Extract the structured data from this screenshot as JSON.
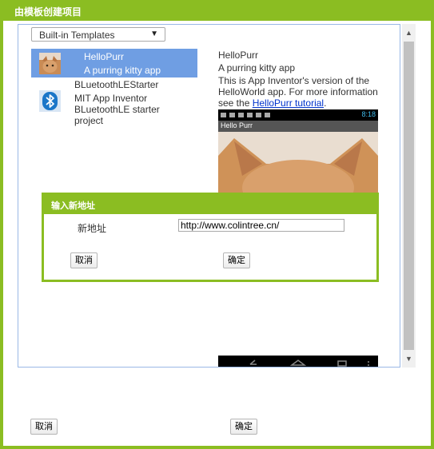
{
  "outer_dialog": {
    "title": "由模板创建项目",
    "cancel_label": "取消",
    "ok_label": "确定"
  },
  "template_select": {
    "value": "Built-in Templates",
    "arrow": "▼"
  },
  "templates": [
    {
      "name": "HelloPurr",
      "description": "A purring kitty app",
      "icon": "cat-thumbnail-icon",
      "selected": true
    },
    {
      "name": "BLuetoothLEStarter",
      "description": "MIT App Inventor BLuetoothLE starter project",
      "icon": "bluetooth-icon",
      "selected": false
    }
  ],
  "preview": {
    "title": "HelloPurr",
    "subtitle": "A purring kitty app",
    "description_prefix": "This is App Inventor's version of the HelloWorld app. For more information see the ",
    "link_text": "HelloPurr tutorial",
    "description_suffix": ".",
    "phone_clock": "8:18",
    "phone_app_title": "Hello Purr"
  },
  "inner_dialog": {
    "title": "输入新地址",
    "address_label": "新地址",
    "address_value": "http://www.colintree.cn/",
    "cancel_label": "取消",
    "ok_label": "确定"
  },
  "colors": {
    "accent": "#8bbd22",
    "selection": "#6f9ee3",
    "link": "#0033cc"
  }
}
